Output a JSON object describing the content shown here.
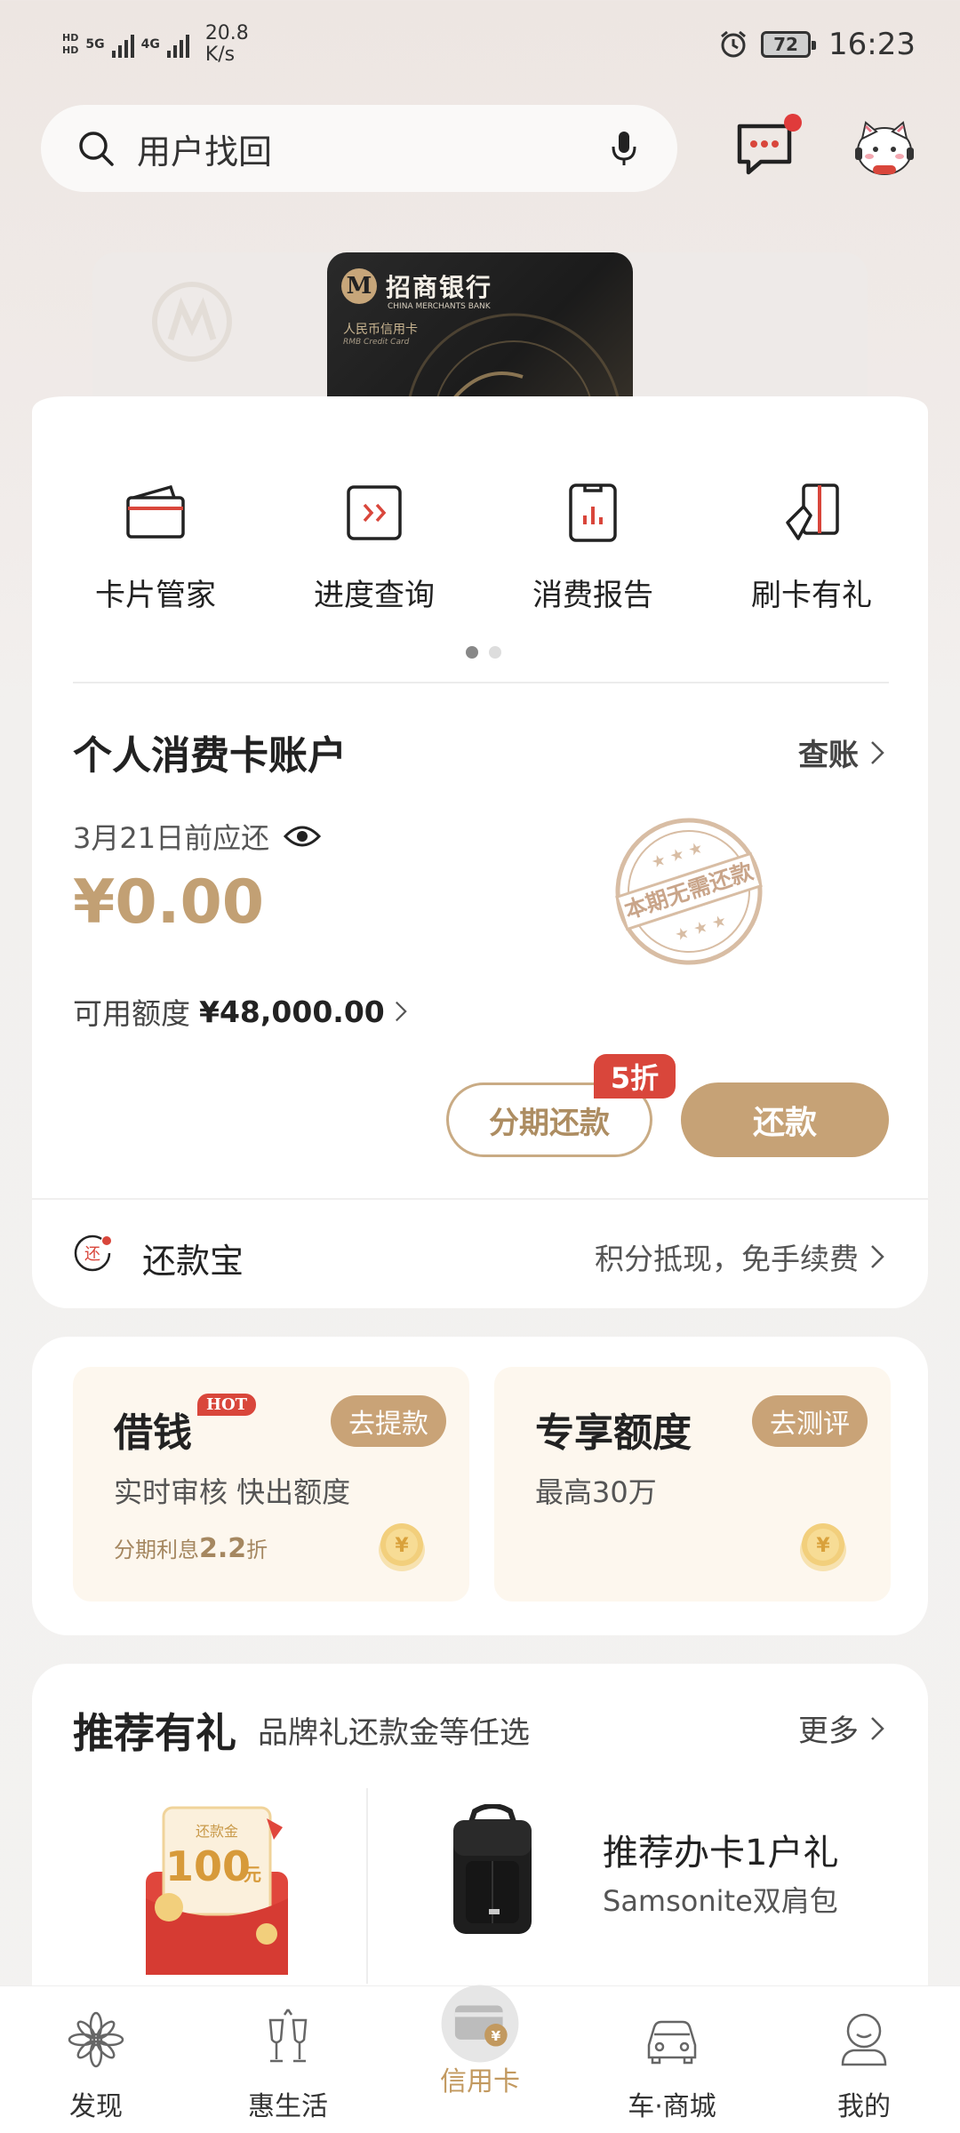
{
  "status_bar": {
    "hd1": "HD",
    "hd2": "HD",
    "net1": "5G",
    "net2": "4G",
    "speed_value": "20.8",
    "speed_unit": "K/s",
    "battery": "72",
    "time": "16:23"
  },
  "search": {
    "text": "用户找回"
  },
  "card": {
    "bank_name": "招商银行",
    "bank_name_en": "CHINA MERCHANTS BANK",
    "card_type": "人民币信用卡",
    "card_type_en": "RMB Credit Card"
  },
  "quick_actions": [
    {
      "label": "卡片管家",
      "icon": "card-wallet-icon"
    },
    {
      "label": "进度查询",
      "icon": "progress-query-icon"
    },
    {
      "label": "消费报告",
      "icon": "spending-report-icon"
    },
    {
      "label": "刷卡有礼",
      "icon": "swipe-gift-icon"
    }
  ],
  "account": {
    "title": "个人消费卡账户",
    "link": "查账",
    "due_text": "3月21日前应还",
    "amount": "¥0.00",
    "stamp_text": "本期无需还款",
    "credit_label": "可用额度",
    "credit_value": "¥48,000.00",
    "installment_btn": "分期还款",
    "discount_tag": "5折",
    "pay_btn": "还款",
    "repay_icon_text": "还",
    "repay_name": "还款宝",
    "repay_desc": "积分抵现，免手续费"
  },
  "loans": [
    {
      "title": "借钱",
      "hot": "HOT",
      "btn": "去提款",
      "desc": "实时审核 快出额度",
      "note_prefix": "分期利息",
      "note_value": "2.2",
      "note_suffix": "折"
    },
    {
      "title": "专享额度",
      "btn": "去测评",
      "desc": "最高30万"
    }
  ],
  "recommend": {
    "title": "推荐有礼",
    "subtitle": "品牌礼还款金等任选",
    "more": "更多",
    "envelope_label": "还款金",
    "envelope_value": "100",
    "envelope_unit": "元",
    "item_title": "推荐办卡1户礼",
    "item_sub": "Samsonite双肩包"
  },
  "bottom_nav": [
    {
      "label": "发现",
      "icon": "discover-icon",
      "active": false
    },
    {
      "label": "惠生活",
      "icon": "life-icon",
      "active": false
    },
    {
      "label": "信用卡",
      "icon": "credit-card-icon",
      "active": true
    },
    {
      "label": "车·商城",
      "icon": "car-mall-icon",
      "active": false
    },
    {
      "label": "我的",
      "icon": "profile-icon",
      "active": false
    }
  ],
  "colors": {
    "accent": "#c6a276",
    "accent_text": "#c2a074",
    "tag_red": "#d9463b",
    "notification": "#e03b3b"
  }
}
